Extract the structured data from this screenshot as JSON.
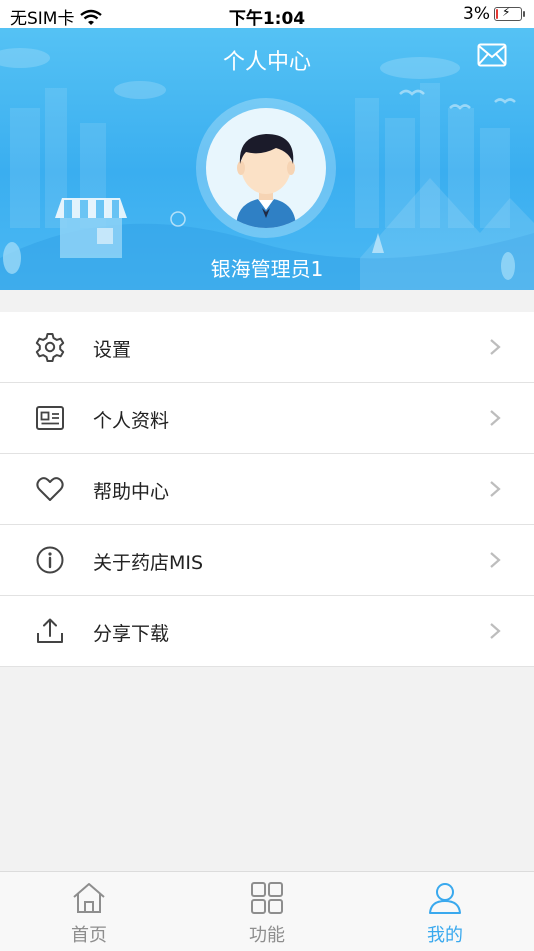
{
  "status_bar": {
    "carrier": "无SIM卡",
    "time": "下午1:04",
    "battery": "3%",
    "battery_level": 0.03
  },
  "header": {
    "title": "个人中心",
    "username": "银海管理员1"
  },
  "menu": [
    {
      "label": "设置",
      "icon": "gear-icon"
    },
    {
      "label": "个人资料",
      "icon": "profile-card-icon"
    },
    {
      "label": "帮助中心",
      "icon": "heart-icon"
    },
    {
      "label": "关于药店MIS",
      "icon": "info-icon"
    },
    {
      "label": "分享下载",
      "icon": "share-upload-icon"
    }
  ],
  "tabbar": [
    {
      "label": "首页",
      "icon": "home-icon",
      "active": false
    },
    {
      "label": "功能",
      "icon": "grid-icon",
      "active": false
    },
    {
      "label": "我的",
      "icon": "user-icon",
      "active": true
    }
  ],
  "colors": {
    "accent": "#3aa9ee",
    "header_bg": "#4cb9f3"
  }
}
